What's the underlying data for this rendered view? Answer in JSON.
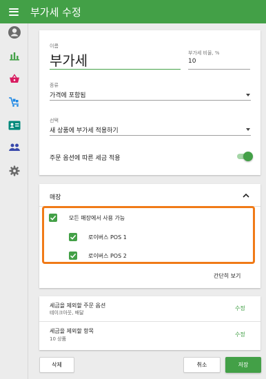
{
  "appbar": {
    "title": "부가세 수정",
    "menu_icon": "menu-icon"
  },
  "sidebar": {
    "items": [
      {
        "name": "account-icon"
      },
      {
        "name": "bar-chart-icon"
      },
      {
        "name": "basket-icon"
      },
      {
        "name": "cart-icon"
      },
      {
        "name": "contact-card-icon"
      },
      {
        "name": "people-icon"
      },
      {
        "name": "gear-icon"
      }
    ]
  },
  "form": {
    "name_label": "이름",
    "name_value": "부가세",
    "rate_label": "부가세 비율, %",
    "rate_value": "10",
    "type_label": "종류",
    "type_value": "가격에 포함됨",
    "option_label": "선택",
    "option_value": "새 상품에 부가세 적용하기",
    "order_option_toggle_label": "주문 옵션에 따른 세금 적용",
    "order_option_toggle_on": true
  },
  "stores": {
    "title": "매장",
    "all_stores_label": "모든 매장에서 사용 가능",
    "items": [
      {
        "label": "로이버스 POS 1",
        "checked": true
      },
      {
        "label": "로이버스 POS 2",
        "checked": true
      }
    ],
    "all_checked": true,
    "collapse_label": "간단히 보기"
  },
  "exclusions": {
    "order_options_title": "세금을 제외할 주문 옵션",
    "order_options_sub": "테이크아웃, 배달",
    "order_options_edit": "수정",
    "items_title": "세금을 제외할 항목",
    "items_sub": "10 상품",
    "items_edit": "수정"
  },
  "footer": {
    "delete": "삭제",
    "cancel": "취소",
    "save": "저장"
  },
  "colors": {
    "primary": "#43a047",
    "highlight": "#f07a17"
  }
}
